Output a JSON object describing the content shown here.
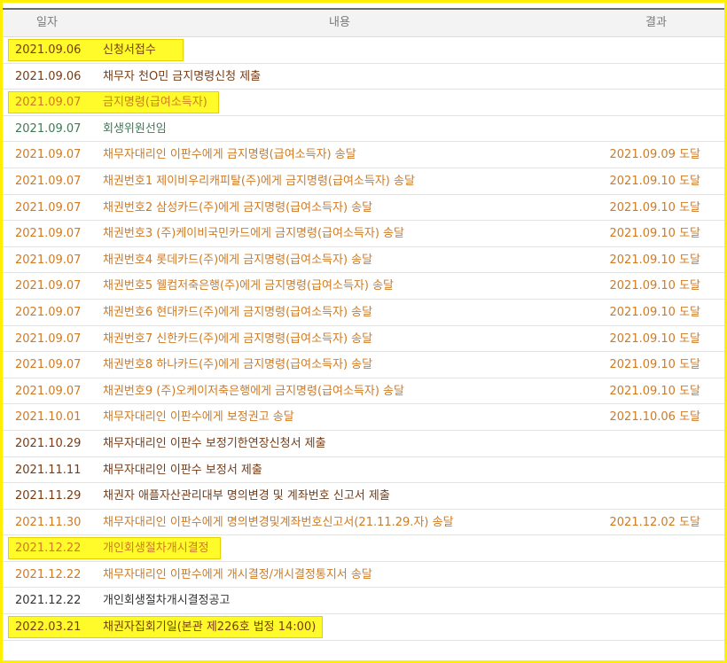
{
  "header": {
    "date": "일자",
    "content": "내용",
    "result": "결과"
  },
  "rows": [
    {
      "date": "2021.09.06",
      "content": "신청서접수",
      "result": "",
      "color": "#7a3b12",
      "highlight": true,
      "hl_width": 198
    },
    {
      "date": "2021.09.06",
      "content": "채무자 천O민 금지명령신청 제출",
      "result": "",
      "color": "#7a3b12",
      "highlight": false
    },
    {
      "date": "2021.09.07",
      "content": "금지명령(급여소득자)",
      "result": "",
      "color": "#d07a22",
      "highlight": true,
      "hl_width": 238
    },
    {
      "date": "2021.09.07",
      "content": "회생위원선임",
      "result": "",
      "color": "#3f7a56",
      "highlight": false
    },
    {
      "date": "2021.09.07",
      "content": "채무자대리인 이판수에게 금지명령(급여소득자) 송달",
      "result": "2021.09.09 도달",
      "color": "#d07a22",
      "highlight": false
    },
    {
      "date": "2021.09.07",
      "content": "채권번호1 제이비우리캐피탈(주)에게 금지명령(급여소득자) 송달",
      "result": "2021.09.10 도달",
      "color": "#d07a22",
      "highlight": false
    },
    {
      "date": "2021.09.07",
      "content": "채권번호2 삼성카드(주)에게 금지명령(급여소득자) 송달",
      "result": "2021.09.10 도달",
      "color": "#d07a22",
      "highlight": false
    },
    {
      "date": "2021.09.07",
      "content": "채권번호3 (주)케이비국민카드에게 금지명령(급여소득자) 송달",
      "result": "2021.09.10 도달",
      "color": "#d07a22",
      "highlight": false
    },
    {
      "date": "2021.09.07",
      "content": "채권번호4 롯데카드(주)에게 금지명령(급여소득자) 송달",
      "result": "2021.09.10 도달",
      "color": "#d07a22",
      "highlight": false
    },
    {
      "date": "2021.09.07",
      "content": "채권번호5 웰컴저축은행(주)에게 금지명령(급여소득자) 송달",
      "result": "2021.09.10 도달",
      "color": "#d07a22",
      "highlight": false
    },
    {
      "date": "2021.09.07",
      "content": "채권번호6 현대카드(주)에게 금지명령(급여소득자) 송달",
      "result": "2021.09.10 도달",
      "color": "#d07a22",
      "highlight": false
    },
    {
      "date": "2021.09.07",
      "content": "채권번호7 신한카드(주)에게 금지명령(급여소득자) 송달",
      "result": "2021.09.10 도달",
      "color": "#d07a22",
      "highlight": false
    },
    {
      "date": "2021.09.07",
      "content": "채권번호8 하나카드(주)에게 금지명령(급여소득자) 송달",
      "result": "2021.09.10 도달",
      "color": "#d07a22",
      "highlight": false
    },
    {
      "date": "2021.09.07",
      "content": "채권번호9 (주)오케이저축은행에게 금지명령(급여소득자) 송달",
      "result": "2021.09.10 도달",
      "color": "#d07a22",
      "highlight": false
    },
    {
      "date": "2021.10.01",
      "content": "채무자대리인 이판수에게 보정권고 송달",
      "result": "2021.10.06 도달",
      "color": "#d07a22",
      "highlight": false
    },
    {
      "date": "2021.10.29",
      "content": "채무자대리인 이판수 보정기한연장신청서 제출",
      "result": "",
      "color": "#7a3b12",
      "highlight": false
    },
    {
      "date": "2021.11.11",
      "content": "채무자대리인 이판수 보정서 제출",
      "result": "",
      "color": "#7a3b12",
      "highlight": false
    },
    {
      "date": "2021.11.29",
      "content": "채권자 애플자산관리대부 명의변경 및 계좌번호 신고서 제출",
      "result": "",
      "color": "#7a3b12",
      "highlight": false
    },
    {
      "date": "2021.11.30",
      "content": "채무자대리인 이판수에게 명의변경및계좌번호신고서(21.11.29.자) 송달",
      "result": "2021.12.02 도달",
      "color": "#d07a22",
      "highlight": false
    },
    {
      "date": "2021.12.22",
      "content": "개인회생절차개시결정",
      "result": "",
      "color": "#d07a22",
      "highlight": true,
      "hl_width": 240
    },
    {
      "date": "2021.12.22",
      "content": "채무자대리인 이판수에게 개시결정/개시결정통지서 송달",
      "result": "",
      "color": "#d07a22",
      "highlight": false
    },
    {
      "date": "2021.12.22",
      "content": "개인회생절차개시결정공고",
      "result": "",
      "color": "#333333",
      "highlight": false
    },
    {
      "date": "2022.03.21",
      "content": "채권자집회기일(본관 제226호 법정 14:00)",
      "result": "",
      "color": "#7a3b12",
      "highlight": true,
      "hl_width": 355
    }
  ]
}
